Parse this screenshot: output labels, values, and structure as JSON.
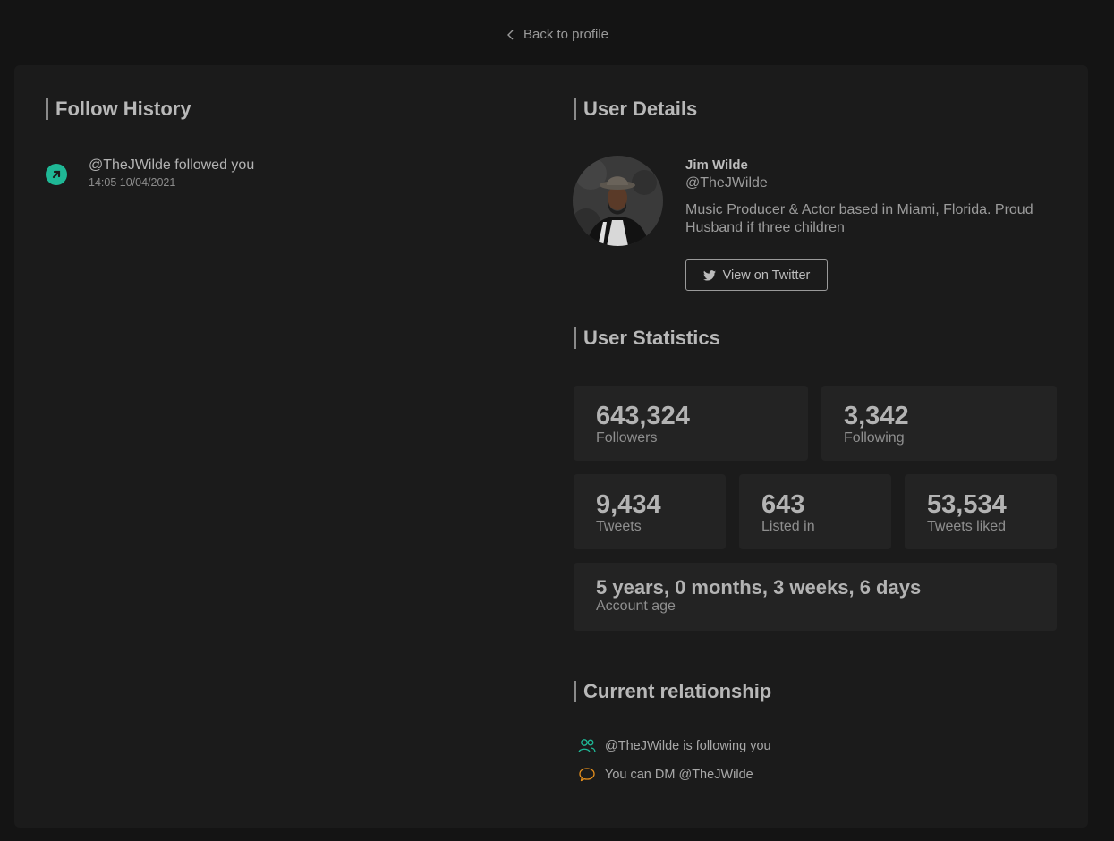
{
  "nav": {
    "back_label": "Back to profile"
  },
  "follow_history": {
    "title": "Follow History",
    "items": [
      {
        "text": "@TheJWilde followed you",
        "time": "14:05 10/04/2021",
        "icon": "arrow-up-right-icon"
      }
    ]
  },
  "user_details": {
    "title": "User Details",
    "name": "Jim Wilde",
    "handle": "@TheJWilde",
    "bio": "Music Producer & Actor based in Miami, Florida. Proud Husband if three children",
    "twitter_button": "View on Twitter"
  },
  "user_statistics": {
    "title": "User Statistics",
    "followers": {
      "value": "643,324",
      "label": "Followers"
    },
    "following": {
      "value": "3,342",
      "label": "Following"
    },
    "tweets": {
      "value": "9,434",
      "label": "Tweets"
    },
    "listed": {
      "value": "643",
      "label": "Listed in"
    },
    "liked": {
      "value": "53,534",
      "label": "Tweets liked"
    },
    "account_age": {
      "value": "5 years, 0 months, 3 weeks, 6 days",
      "label": "Account age"
    }
  },
  "relationship": {
    "title": "Current relationship",
    "items": [
      {
        "text": "@TheJWilde is following you",
        "icon": "users-icon"
      },
      {
        "text": "You can DM @TheJWilde",
        "icon": "message-icon"
      }
    ]
  },
  "colors": {
    "accent_green": "#1fb896",
    "accent_orange": "#e8901c",
    "background": "#141414",
    "panel": "#1b1b1b"
  }
}
